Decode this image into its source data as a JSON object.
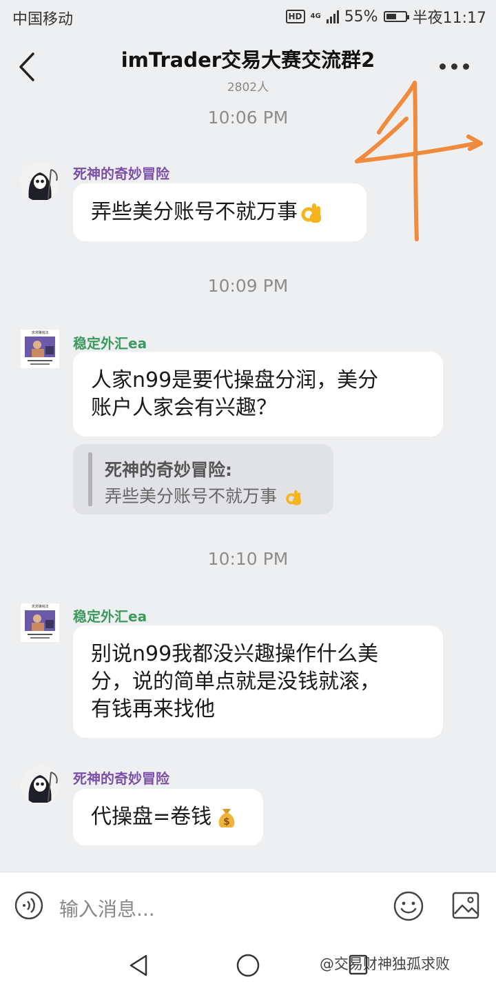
{
  "status_bar": {
    "carrier": "中国移动",
    "hd": "HD",
    "network": "4G",
    "battery_percent": "55%",
    "battery_level": 0.55,
    "time": "半夜11:17"
  },
  "header": {
    "title": "imTrader交易大赛交流群2",
    "member_count": "2802人"
  },
  "doodle_text": "4",
  "timestamps": [
    "10:06 PM",
    "10:09 PM",
    "10:10 PM"
  ],
  "messages": [
    {
      "sender": "死神的奇妙冒险",
      "text": "弄些美分账号不就万事",
      "emoji": "ok-hand"
    },
    {
      "sender": "稳定外汇ea",
      "lines": [
        "人家n99是要代操盘分润，美分",
        "账户人家会有兴趣？"
      ]
    },
    {
      "sender": "稳定外汇ea",
      "lines": [
        "别说n99我都没兴趣操作什么美",
        "分，说的简单点就是没钱就滚，",
        "有钱再来找他"
      ]
    },
    {
      "sender": "死神的奇妙冒险",
      "text": "代操盘=卷钱",
      "emoji": "money-bag"
    }
  ],
  "quote": {
    "name": "死神的奇妙冒险:",
    "text": "弄些美分账号不就万事"
  },
  "avatar_caption": "求求赚钱法",
  "input": {
    "placeholder": "输入消息..."
  },
  "watermark": "@交易财神独孤求败",
  "colors": {
    "background": "#eeeff1",
    "bubble": "#ffffff",
    "sender_purple": "#7b4fa8",
    "sender_green": "#3b9a5e",
    "doodle": "#f08a3c"
  }
}
